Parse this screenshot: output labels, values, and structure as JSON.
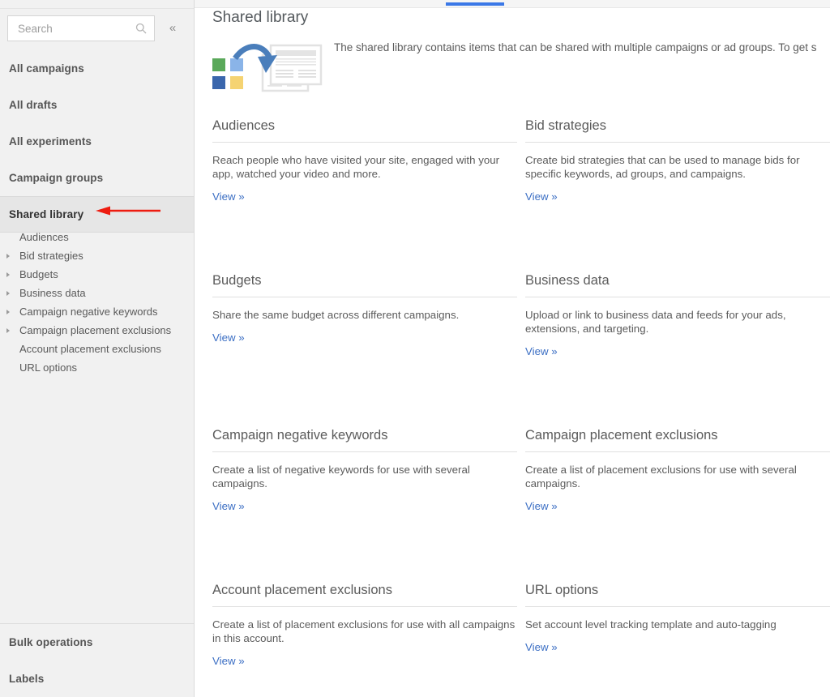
{
  "sidebar": {
    "search": {
      "placeholder": "Search",
      "value": "",
      "icon": "search-icon"
    },
    "collapse_label": "«",
    "top_items": [
      {
        "label": "All campaigns",
        "active": false
      },
      {
        "label": "All drafts",
        "active": false
      },
      {
        "label": "All experiments",
        "active": false
      },
      {
        "label": "Campaign groups",
        "active": false
      },
      {
        "label": "Shared library",
        "active": true
      }
    ],
    "sub_items": [
      {
        "label": "Audiences",
        "expandable": false
      },
      {
        "label": "Bid strategies",
        "expandable": true
      },
      {
        "label": "Budgets",
        "expandable": true
      },
      {
        "label": "Business data",
        "expandable": true
      },
      {
        "label": "Campaign negative keywords",
        "expandable": true
      },
      {
        "label": "Campaign placement exclusions",
        "expandable": true
      },
      {
        "label": "Account placement exclusions",
        "expandable": false
      },
      {
        "label": "URL options",
        "expandable": false
      }
    ],
    "bottom_items": [
      {
        "label": "Bulk operations"
      },
      {
        "label": "Labels"
      }
    ]
  },
  "annotation": {
    "type": "arrow",
    "direction": "left",
    "color": "#ee1c10",
    "points_at": "Shared library"
  },
  "main": {
    "title": "Shared library",
    "tab_indicator_color": "#3b78e7",
    "intro_text": "The shared library contains items that can be shared with multiple campaigns or ad groups. To get s",
    "illustration": {
      "name": "shared-library-illustration",
      "colors": [
        "#5aa95a",
        "#8ab4e8",
        "#3a66ac",
        "#f5d372",
        "#4a7ebb"
      ]
    },
    "cards": [
      {
        "title": "Audiences",
        "description": "Reach people who have visited your site, engaged with your app, watched your video and more.",
        "link": "View »"
      },
      {
        "title": "Bid strategies",
        "description": "Create bid strategies that can be used to manage bids for specific keywords, ad groups, and campaigns.",
        "link": "View »"
      },
      {
        "title": "Budgets",
        "description": "Share the same budget across different campaigns.",
        "link": "View »"
      },
      {
        "title": "Business data",
        "description": "Upload or link to business data and feeds for your ads, extensions, and targeting.",
        "link": "View »"
      },
      {
        "title": "Campaign negative keywords",
        "description": "Create a list of negative keywords for use with several campaigns.",
        "link": "View »"
      },
      {
        "title": "Campaign placement exclusions",
        "description": "Create a list of placement exclusions for use with several campaigns.",
        "link": "View »"
      },
      {
        "title": "Account placement exclusions",
        "description": "Create a list of placement exclusions for use with all campaigns in this account.",
        "link": "View »"
      },
      {
        "title": "URL options",
        "description": "Set account level tracking template and auto-tagging",
        "link": "View »"
      }
    ]
  }
}
